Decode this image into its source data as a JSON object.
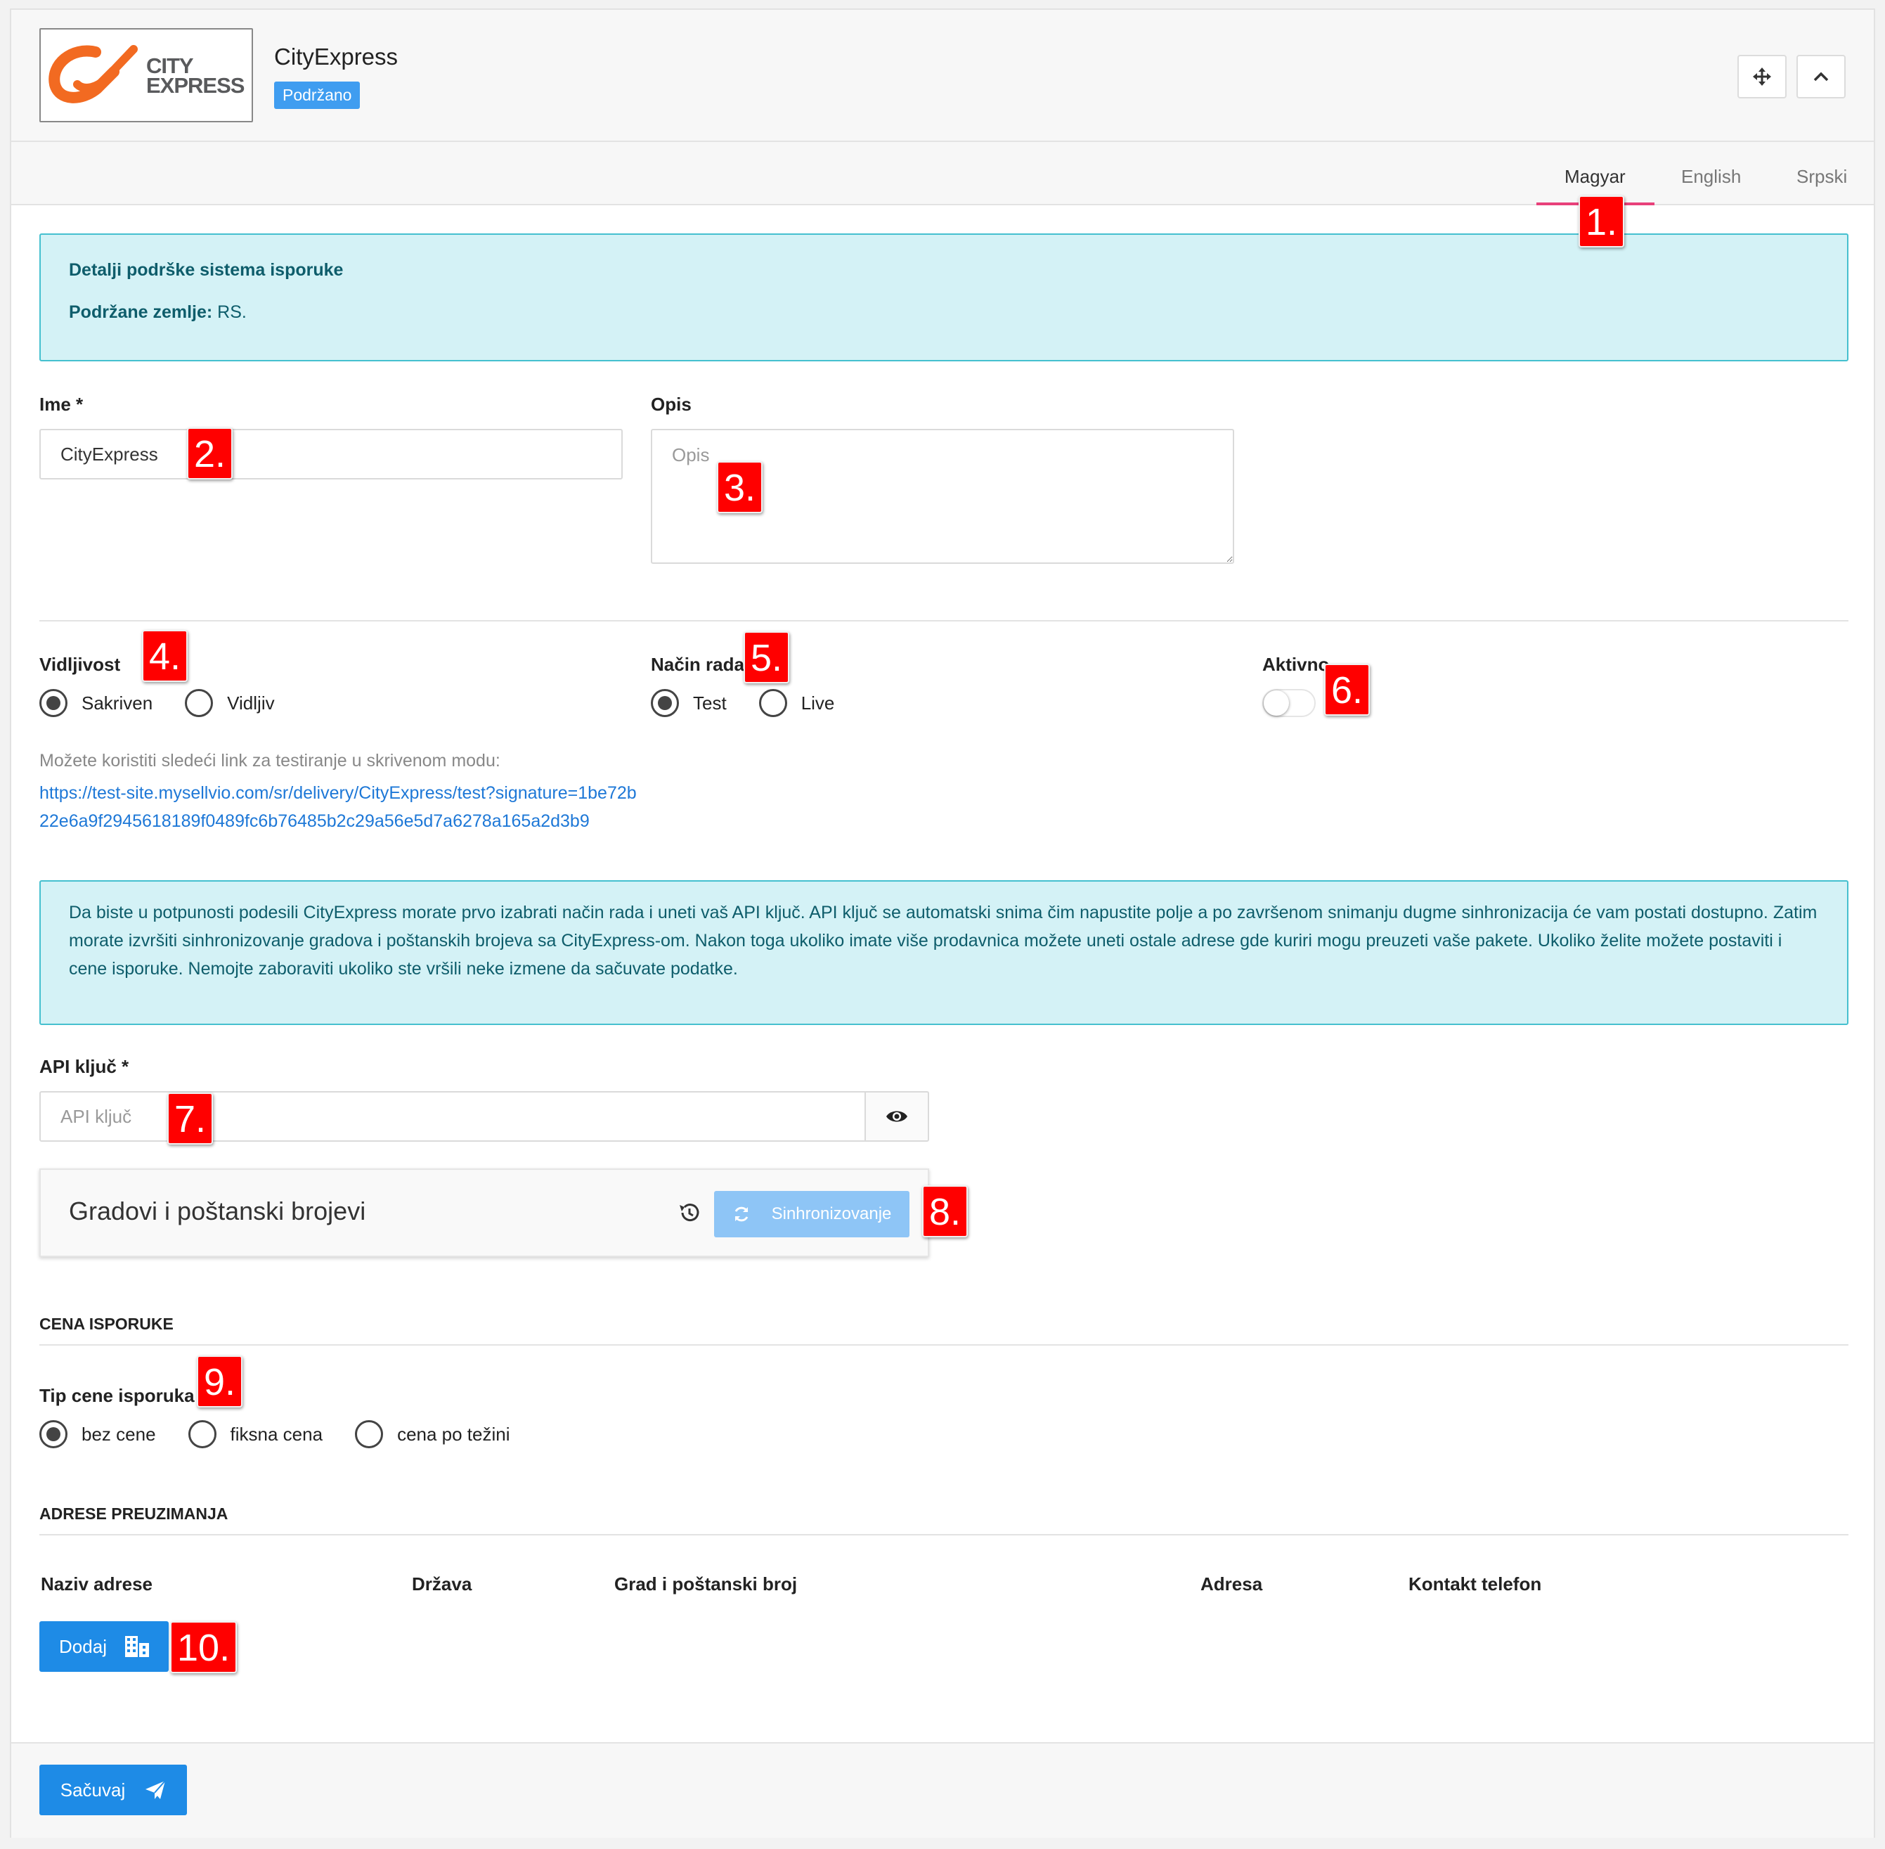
{
  "header": {
    "logo_text_line1": "CITY",
    "logo_text_line2": "EXPRESS",
    "title": "CityExpress",
    "badge": "Podržano",
    "move_icon": "move-icon",
    "collapse_icon": "chevron-up-icon"
  },
  "tabs": [
    {
      "label": "Magyar",
      "active": true
    },
    {
      "label": "English",
      "active": false
    },
    {
      "label": "Srpski",
      "active": false
    }
  ],
  "support_info": {
    "heading": "Detalji podrške sistema isporuke",
    "countries_label": "Podržane zemlje:",
    "countries_value": " RS."
  },
  "form": {
    "name_label": "Ime *",
    "name_value": "CityExpress",
    "description_label": "Opis",
    "description_placeholder": "Opis",
    "visibility_label": "Vidljivost",
    "visibility_options": [
      {
        "label": "Sakriven",
        "checked": true
      },
      {
        "label": "Vidljiv",
        "checked": false
      }
    ],
    "mode_label": "Način rada",
    "mode_options": [
      {
        "label": "Test",
        "checked": true
      },
      {
        "label": "Live",
        "checked": false
      }
    ],
    "active_label": "Aktivno",
    "active_on": false,
    "help_text": "Možete koristiti sledeći link za testiranje u skrivenom modu:",
    "test_link": "https://test-site.mysellvio.com/sr/delivery/CityExpress/test?signature=1be72b22e6a9f2945618189f0489fc6b76485b2c29a56e5d7a6278a165a2d3b9"
  },
  "setup_info": "Da biste u potpunosti podesili CityExpress morate prvo izabrati način rada i uneti vaš API ključ. API ključ se automatski snima čim napustite polje a po završenom snimanju dugme sinhronizacija će vam postati dostupno. Zatim morate izvršiti sinhronizovanje gradova i poštanskih brojeva sa CityExpress-om. Nakon toga ukoliko imate više prodavnica možete uneti ostale adrese gde kuriri mogu preuzeti vaše pakete. Ukoliko želite možete postaviti i cene isporuke. Nemojte zaboraviti ukoliko ste vršili neke izmene da sačuvate podatke.",
  "api": {
    "label": "API ključ *",
    "placeholder": "API ključ",
    "eye_icon": "eye-icon"
  },
  "sync": {
    "title": "Gradovi i poštanski brojevi",
    "history_icon": "history-icon",
    "button_label": "Sinhronizovanje",
    "button_icon": "refresh-icon"
  },
  "pricing": {
    "section_title": "CENA ISPORUKE",
    "type_label": "Tip cene isporuka",
    "options": [
      {
        "label": "bez cene",
        "checked": true
      },
      {
        "label": "fiksna cena",
        "checked": false
      },
      {
        "label": "cena po težini",
        "checked": false
      }
    ]
  },
  "pickup": {
    "section_title": "ADRESE PREUZIMANJA",
    "columns": [
      "Naziv adrese",
      "Država",
      "Grad i poštanski broj",
      "Adresa",
      "Kontakt telefon"
    ],
    "add_label": "Dodaj",
    "add_icon": "building-icon"
  },
  "footer": {
    "save_label": "Sačuvaj",
    "save_icon": "send-icon"
  },
  "markers": [
    "1.",
    "2.",
    "3.",
    "4.",
    "5.",
    "6.",
    "7.",
    "8.",
    "9.",
    "10."
  ],
  "colors": {
    "accent": "#1e8be6",
    "badge": "#3f9df0",
    "tab_underline": "#e8407a",
    "info_bg": "#d4f2f6",
    "info_border": "#45c0cf",
    "marker": "#ff0000",
    "logo_orange": "#f26a21"
  }
}
